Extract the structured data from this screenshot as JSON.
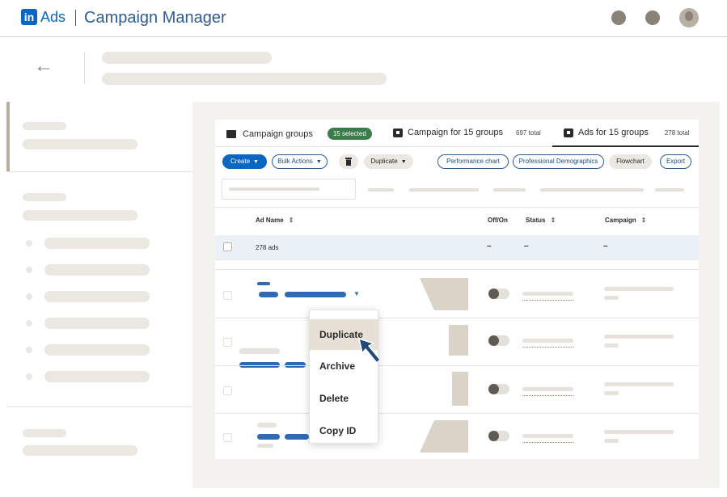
{
  "header": {
    "logo_letters": "in",
    "logo_text": "Ads",
    "app_title": "Campaign Manager"
  },
  "nav": {
    "back_glyph": "←"
  },
  "tabs": [
    {
      "label": "Campaign groups",
      "badge": "15 selected",
      "icon": "folder-icon"
    },
    {
      "label": "Campaign for 15 groups",
      "count": "697 total",
      "icon": "campaign-icon"
    },
    {
      "label": "Ads for 15 groups",
      "count": "278 total",
      "icon": "ads-icon",
      "active": true
    }
  ],
  "toolbar": {
    "create_label": "Create",
    "bulk_actions_label": "Bulk Actions",
    "duplicate_label": "Duplicate",
    "performance_chart_label": "Performance chart",
    "professional_demographics_label": "Professional Demographics",
    "flowchart_label": "Flowchart",
    "export_label": "Export"
  },
  "table": {
    "columns": [
      "Ad Name",
      "Off/On",
      "Status",
      "Campaign"
    ],
    "summary_row": {
      "label": "278 ads",
      "off_on": "–",
      "status": "–",
      "campaign": "–"
    }
  },
  "menu": {
    "items": [
      "Duplicate",
      "Archive",
      "Delete",
      "Copy ID"
    ],
    "active": "Duplicate"
  },
  "colors": {
    "brand": "#0a66c2",
    "badge_green": "#3a7c4a",
    "highlight_row": "#eaf1f8",
    "menu_hover": "#e6e0d7"
  }
}
